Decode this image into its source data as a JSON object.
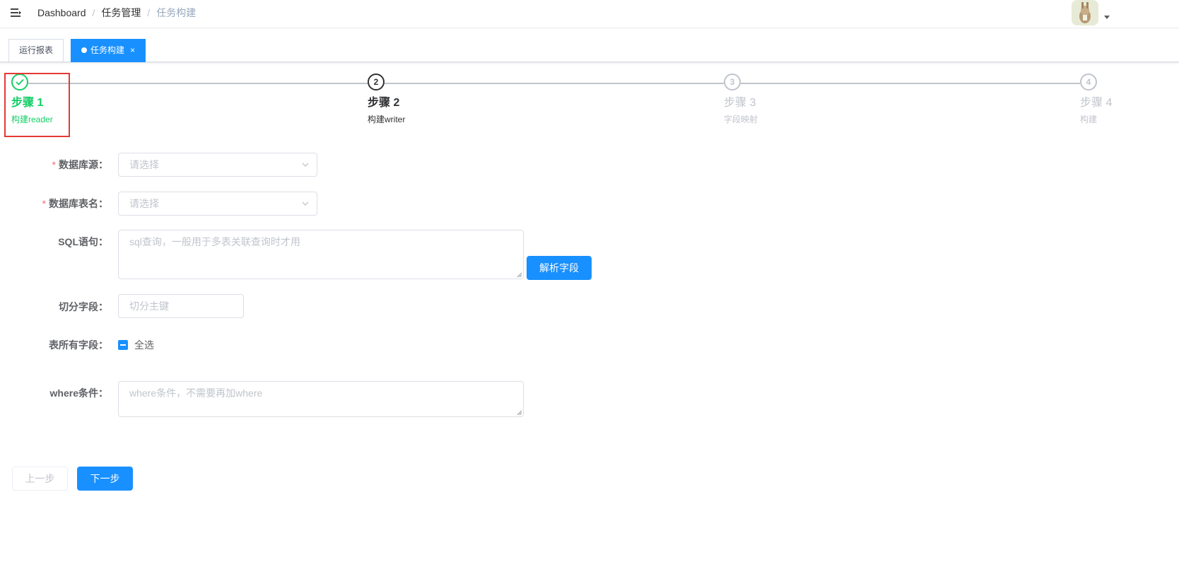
{
  "navbar": {
    "breadcrumb": [
      "Dashboard",
      "任务管理",
      "任务构建"
    ],
    "separator": "/"
  },
  "tags": [
    {
      "label": "运行报表",
      "active": false
    },
    {
      "label": "任务构建",
      "active": true,
      "close": "×"
    }
  ],
  "steps": [
    {
      "title": "步骤 1",
      "desc": "构建reader",
      "status": "success",
      "icon": "check-icon"
    },
    {
      "title": "步骤 2",
      "desc": "构建writer",
      "status": "process",
      "number": "2"
    },
    {
      "title": "步骤 3",
      "desc": "字段映射",
      "status": "wait",
      "number": "3"
    },
    {
      "title": "步骤 4",
      "desc": "构建",
      "status": "wait",
      "number": "4"
    }
  ],
  "form": {
    "required_mark": "*",
    "datasource": {
      "label": "数据库源：",
      "placeholder": "请选择"
    },
    "table": {
      "label": "数据库表名：",
      "placeholder": "请选择"
    },
    "sql": {
      "label": "SQL语句：",
      "placeholder": "sql查询，一般用于多表关联查询时才用"
    },
    "parse_button": "解析字段",
    "split": {
      "label": "切分字段：",
      "placeholder": "切分主键"
    },
    "columns": {
      "label": "表所有字段：",
      "select_all": "全选"
    },
    "where": {
      "label": "where条件：",
      "placeholder": "where条件，不需要再加where"
    }
  },
  "footer": {
    "prev": "上一步",
    "next": "下一步"
  },
  "colors": {
    "primary": "#1890ff",
    "success": "#13ce66",
    "highlight": "#e53935",
    "required": "#f56c6c"
  }
}
